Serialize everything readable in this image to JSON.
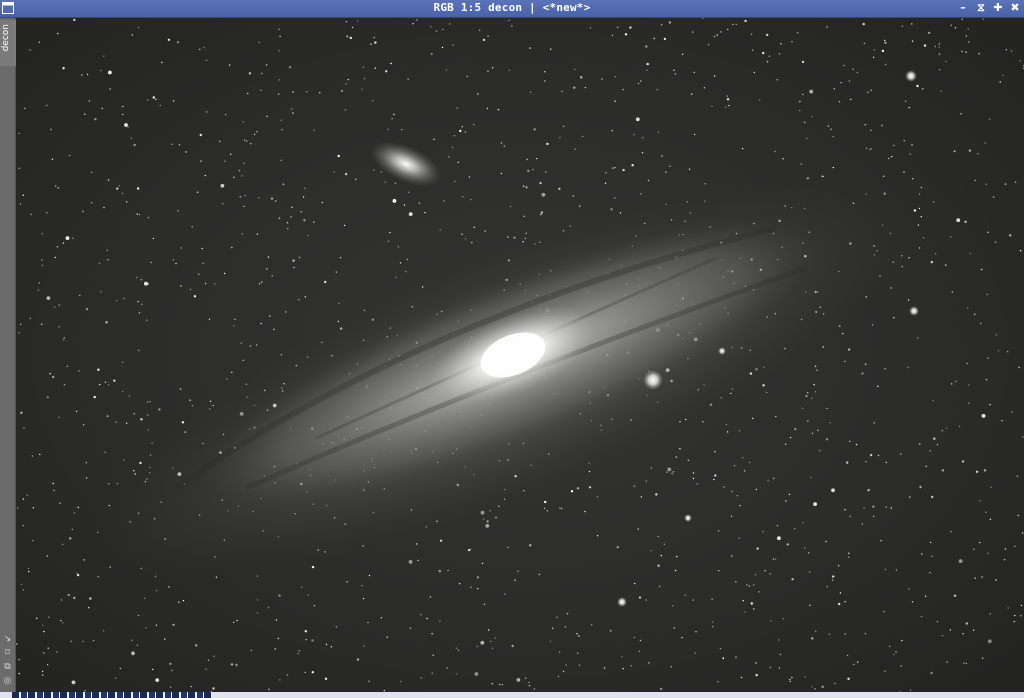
{
  "window": {
    "title": "RGB 1:5 decon | <*new*>",
    "accent_color": "#4a62a8",
    "controls": [
      {
        "name": "minimize",
        "glyph": "–"
      },
      {
        "name": "shade",
        "glyph": "⧖"
      },
      {
        "name": "maximize",
        "glyph": "✚"
      },
      {
        "name": "close",
        "glyph": "✖"
      }
    ]
  },
  "sidebar": {
    "view_tab_label": "decon",
    "tab_indicator_color": "#3cb043",
    "tools": [
      {
        "name": "zoom-arrow",
        "glyph": "↘"
      },
      {
        "name": "fit",
        "glyph": "⌑"
      },
      {
        "name": "clone",
        "glyph": "⧉"
      },
      {
        "name": "target",
        "glyph": "◎"
      }
    ]
  },
  "image": {
    "subject": "Andromeda Galaxy (M31) with M110 companion",
    "background_color": "#2b2b2a"
  }
}
